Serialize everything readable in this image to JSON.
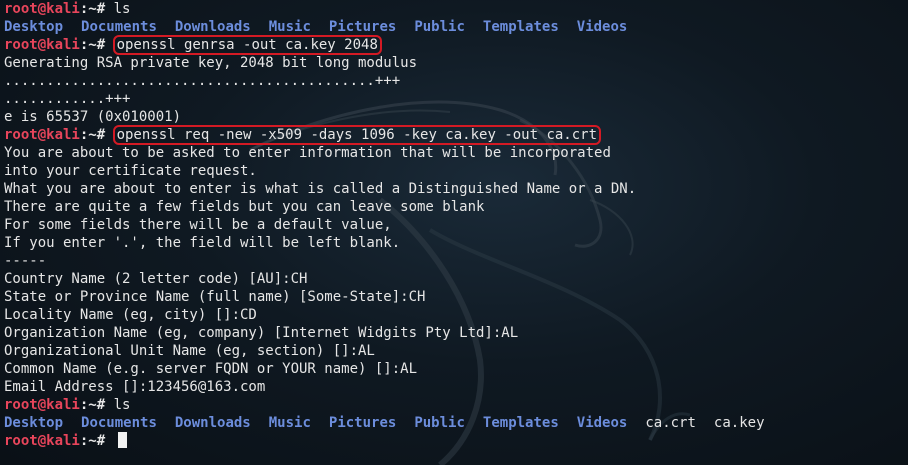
{
  "prompt": {
    "user": "root@kali",
    "sep": ":~# "
  },
  "commands": {
    "ls1": "ls",
    "genrsa": "openssl genrsa -out ca.key 2048",
    "req": "openssl req -new -x509 -days 1096 -key ca.key -out ca.crt",
    "ls2": "ls"
  },
  "ls1_output": [
    "Desktop",
    "Documents",
    "Downloads",
    "Music",
    "Pictures",
    "Public",
    "Templates",
    "Videos"
  ],
  "genrsa_output": [
    "Generating RSA private key, 2048 bit long modulus",
    "............................................+++",
    "............+++",
    "e is 65537 (0x010001)"
  ],
  "req_output": [
    "You are about to be asked to enter information that will be incorporated",
    "into your certificate request.",
    "What you are about to enter is what is called a Distinguished Name or a DN.",
    "There are quite a few fields but you can leave some blank",
    "For some fields there will be a default value,",
    "If you enter '.', the field will be left blank.",
    "-----",
    "Country Name (2 letter code) [AU]:CH",
    "State or Province Name (full name) [Some-State]:CH",
    "Locality Name (eg, city) []:CD",
    "Organization Name (eg, company) [Internet Widgits Pty Ltd]:AL",
    "Organizational Unit Name (eg, section) []:AL",
    "Common Name (e.g. server FQDN or YOUR name) []:AL",
    "Email Address []:123456@163.com"
  ],
  "ls2_output": {
    "dirs": [
      "Desktop",
      "Documents",
      "Downloads",
      "Music",
      "Pictures",
      "Public",
      "Templates",
      "Videos"
    ],
    "files": [
      "ca.crt",
      "ca.key"
    ]
  },
  "colors": {
    "prompt_user": "#e8455b",
    "directory": "#6c8ddc",
    "highlight_box": "#d41a24",
    "background": "#0f1922"
  }
}
